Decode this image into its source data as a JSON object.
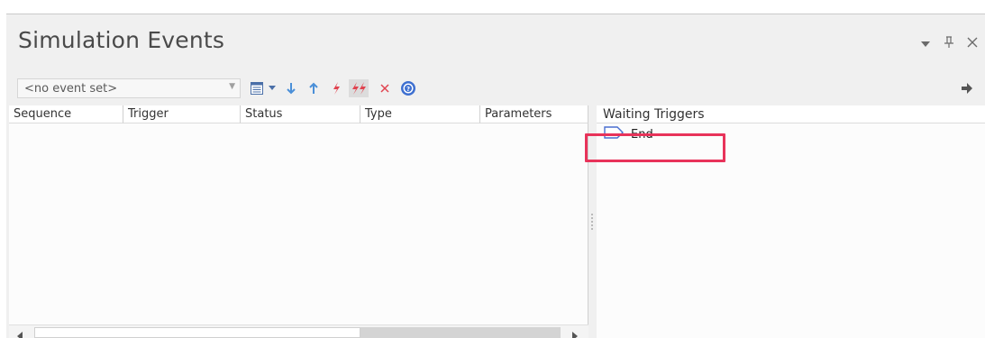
{
  "window": {
    "title": "Simulation Events",
    "controls": [
      "dropdown-icon",
      "pin-icon",
      "close-icon"
    ]
  },
  "toolbar": {
    "event_set_value": "<no event set>",
    "buttons": [
      {
        "name": "list-view-icon",
        "tooltip": ""
      },
      {
        "name": "move-down-icon"
      },
      {
        "name": "move-up-icon"
      },
      {
        "name": "fire-event-icon"
      },
      {
        "name": "fire-all-events-icon"
      },
      {
        "name": "delete-icon"
      },
      {
        "name": "help-icon"
      },
      {
        "name": "arrow-right-icon"
      }
    ],
    "colors": {
      "blue": "#4a8fd8",
      "red": "#e0434f",
      "helpBlue": "#3d6fd0"
    }
  },
  "events_grid": {
    "columns": [
      "Sequence",
      "Trigger",
      "Status",
      "Type",
      "Parameters"
    ],
    "rows": []
  },
  "waiting_triggers": {
    "header": "Waiting Triggers",
    "items": [
      {
        "label": "End",
        "icon": "signal-icon"
      }
    ],
    "highlight_color": "#e8335a"
  }
}
